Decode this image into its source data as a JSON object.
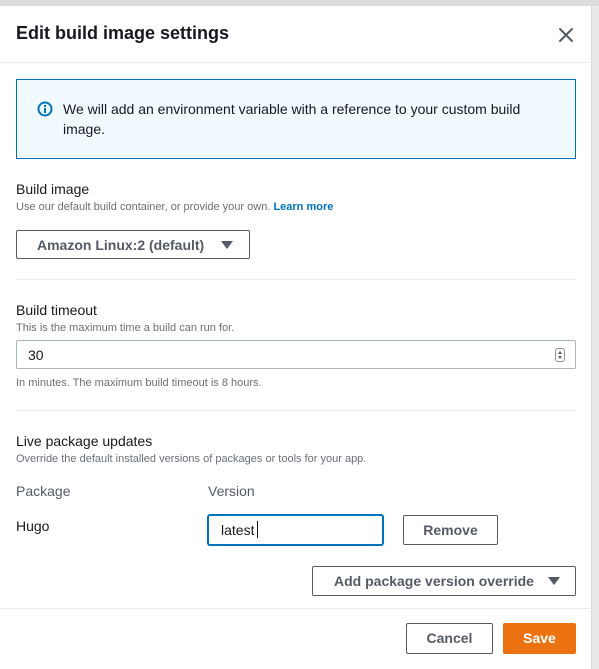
{
  "modal": {
    "title": "Edit build image settings",
    "close_icon": "close-icon"
  },
  "alert": {
    "icon": "info-icon",
    "text": "We will add an environment variable with a reference to your custom build image."
  },
  "build_image": {
    "label": "Build image",
    "description": "Use our default build container, or provide your own.",
    "learn_more": "Learn more",
    "selected": "Amazon Linux:2 (default)"
  },
  "build_timeout": {
    "label": "Build timeout",
    "description": "This is the maximum time a build can run for.",
    "value": "30",
    "hint": "In minutes. The maximum build timeout is 8 hours."
  },
  "live_updates": {
    "label": "Live package updates",
    "description": "Override the default installed versions of packages or tools for your app.",
    "column_package": "Package",
    "column_version": "Version",
    "rows": [
      {
        "package": "Hugo",
        "version": "latest",
        "remove_label": "Remove"
      }
    ],
    "add_override_label": "Add package version override"
  },
  "footer": {
    "cancel_label": "Cancel",
    "save_label": "Save"
  },
  "colors": {
    "accent": "#ec7211",
    "link": "#0073bb",
    "alert_bg": "#f1faff"
  }
}
